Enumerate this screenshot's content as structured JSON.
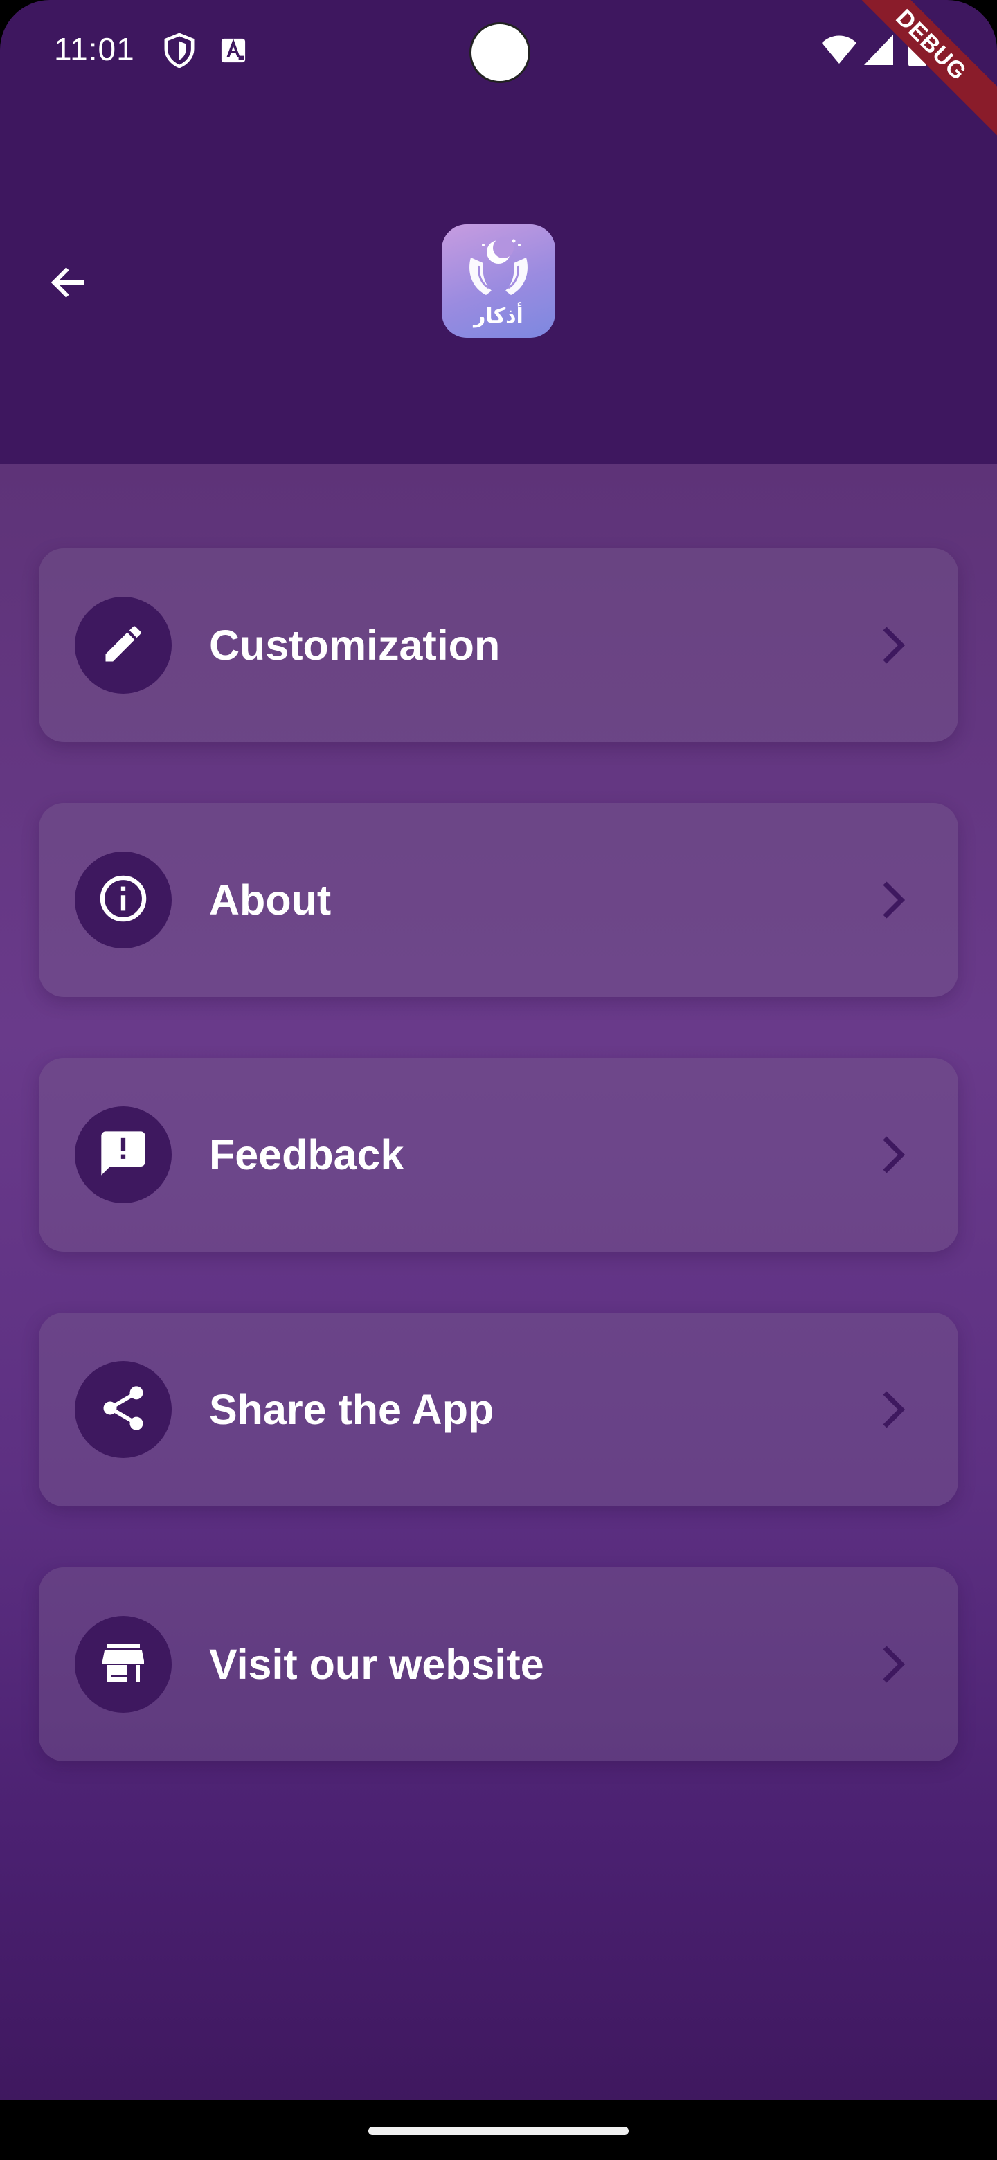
{
  "status_bar": {
    "time": "11:01",
    "debug_label": "DEBUG",
    "icons": [
      "shield-icon",
      "keyboard-a-icon",
      "wifi-icon",
      "signal-icon",
      "battery-icon"
    ]
  },
  "header": {
    "back_icon": "arrow-left-icon",
    "logo_text": "أذكار"
  },
  "menu": {
    "items": [
      {
        "label": "Customization",
        "icon": "pencil-icon"
      },
      {
        "label": "About",
        "icon": "info-icon"
      },
      {
        "label": "Feedback",
        "icon": "feedback-icon"
      },
      {
        "label": "Share the App",
        "icon": "share-icon"
      },
      {
        "label": "Visit our website",
        "icon": "store-icon"
      }
    ]
  },
  "colors": {
    "header_bg": "#3e175f",
    "icon_circle": "#3e185f",
    "chevron": "#3e185f",
    "text": "#ffffff"
  }
}
